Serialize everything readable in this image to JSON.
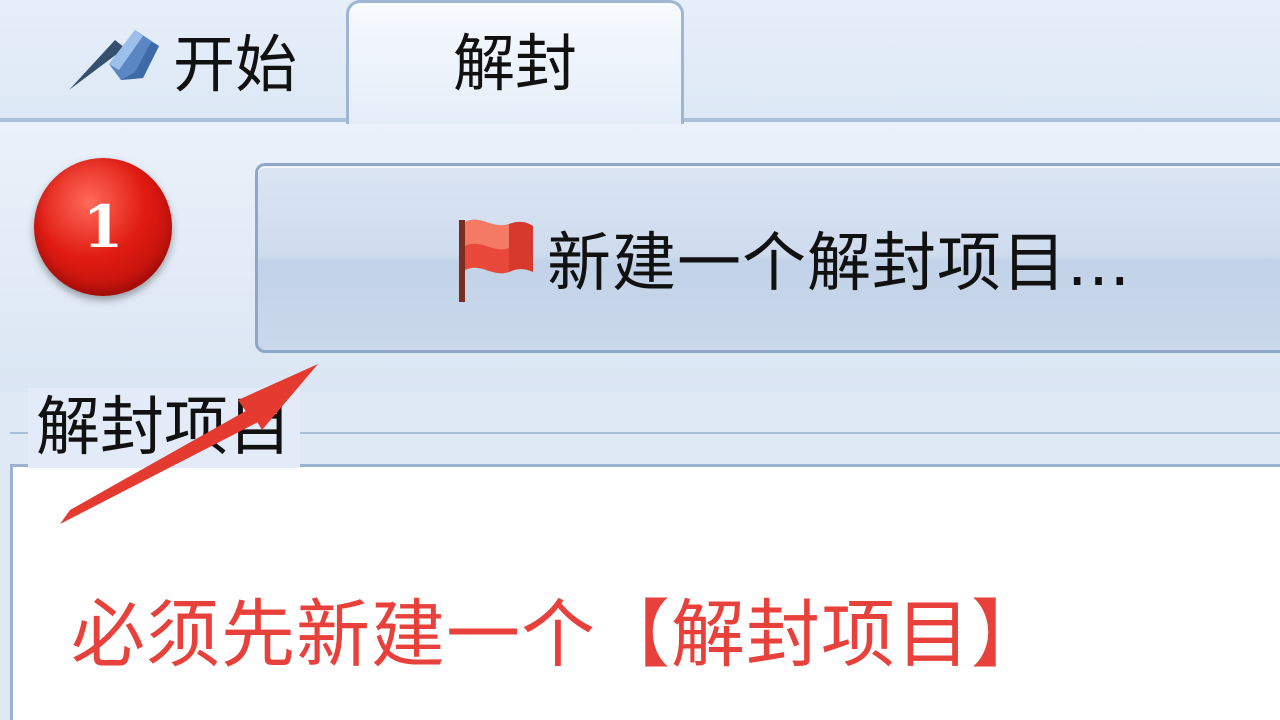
{
  "tabs": {
    "start_label": "开始",
    "unseal_label": "解封"
  },
  "ribbon": {
    "step_number": "1",
    "new_project_label": "新建一个解封项目..."
  },
  "project_group": {
    "title": "解封项目",
    "hint": "必须先新建一个【解封项目】"
  },
  "icons": {
    "start": "pen-icon",
    "new_project": "flag-icon",
    "annotation": "arrow-icon"
  },
  "colors": {
    "accent_red": "#e8403a",
    "badge_red": "#e01b12",
    "tab_border": "#9eb6d3"
  }
}
